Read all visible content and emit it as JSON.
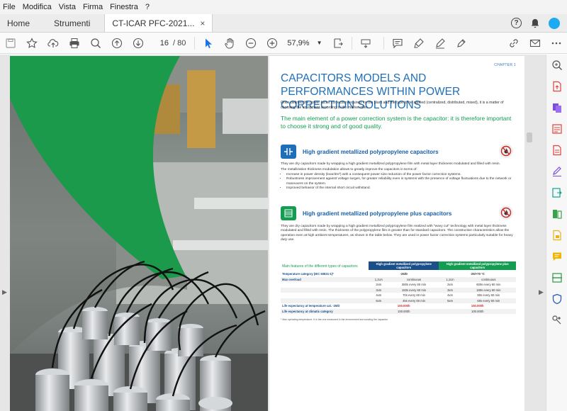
{
  "menu": [
    "File",
    "Modifica",
    "Vista",
    "Firma",
    "Finestra",
    "?"
  ],
  "tabs": {
    "home": "Home",
    "tools": "Strumenti",
    "document": "CT-ICAR PFC-2021...",
    "close": "×"
  },
  "toolbar": {
    "page_current": "16",
    "page_total": "/ 80",
    "zoom": "57,9%"
  },
  "page": {
    "chapter": "CHAPTER 1",
    "title": "CAPACITORS MODELS AND PERFORMANCES WITHIN POWER CORRECTION SOLUTIONS",
    "intro": "Once defined the power factor correction required for the plant and the type to be applied (centralized, distributed, mixed), it is a matter of choosing the equipment according to the market offer.",
    "lead": "The main element of a power correction system is the capacitor: it is therefore important to choose it strong and of good quality.",
    "product1": {
      "name": "High gradient metallized polypropylene capacitors",
      "p1": "They are dry capacitors made by wrapping a high gradient metallized polypropylene film with metal layer thickness modulated and filled with resin.",
      "p2": "The metallization thickness modulation allows to greatly improve the capacitors in terms of:",
      "bullets": [
        "Increase in power density (kvar/dm³) with a consequent power size reduction of the power factor correction systems.",
        "Robustness improvement against voltage surges, for greater reliability even in systems with the presence of voltage fluctuations due to the network or maneuvers on the system.",
        "Improved behavior of the internal short circuit withstand."
      ]
    },
    "product2": {
      "name": "High gradient metallized polypropylene plus capacitors",
      "p1": "They are dry capacitors made by wrapping a high gradient metallized polypropylene film realized with \"wavy cut\" technology with metal layer thickness modulated and filled with resin. The thickness of the polypropylene film is greater than for standard capacitors. The constructive characteristics allow the operation even at high ambient temperatures, as shown in the table below. They are used in power factor correction systems particularly suitable for heavy duty use."
    },
    "table": {
      "features_label": "Main features of the different types of capacitors",
      "col1": "High gradient metallized polypropylene capacitors",
      "col2": "High gradient metallized polypropylene plus capacitors",
      "temp_label": "Temperature category (IEC 60831-1)*",
      "temp1": "-25/D",
      "temp2": "-25/+70 °C",
      "overload_label": "Max overload",
      "rows": [
        [
          "1,1Un",
          "continuous",
          "1,1Un",
          "continuous"
        ],
        [
          "2xIn",
          "380s every 60 min",
          "2xIn",
          "600s every 60 min"
        ],
        [
          "3xIn",
          "150s every 60 min",
          "3xIn",
          "180s every 60 min"
        ],
        [
          "4xIn",
          "70s every 60 min",
          "4xIn",
          "90s every 60 min"
        ],
        [
          "5xIn",
          "45s every 60 min",
          "5xIn",
          "60s every 60 min"
        ]
      ],
      "life_temp_label": "Life expectancy at temperature cat. -25/D",
      "life_temp1": "100.000h",
      "life_temp2": "150.000h",
      "life_clim_label": "Life expectancy at climatic category",
      "life_clim1": "100.000h",
      "life_clim2": "100.000h",
      "footnote": "* Max operating temperature. It is the one measured in the environment surrounding the capacitor"
    }
  },
  "colors": {
    "accent_blue": "#1e6fb8",
    "accent_green": "#139d52",
    "brand_green": "#1a9a4a"
  }
}
